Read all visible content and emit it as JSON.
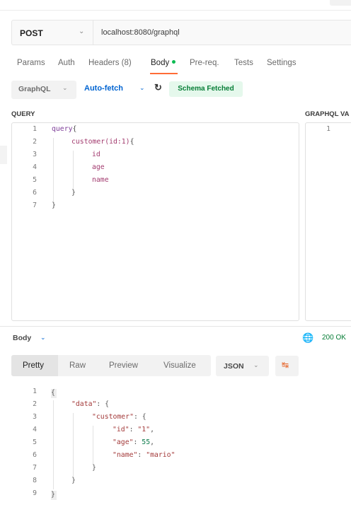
{
  "request": {
    "method": "POST",
    "url": "localhost:8080/graphql"
  },
  "tabs": [
    {
      "label": "Params"
    },
    {
      "label": "Auth"
    },
    {
      "label": "Headers (8)"
    },
    {
      "label": "Body"
    },
    {
      "label": "Pre-req."
    },
    {
      "label": "Tests"
    },
    {
      "label": "Settings"
    }
  ],
  "body_toolbar": {
    "mode": "GraphQL",
    "autofetch": "Auto-fetch",
    "schema_status": "Schema Fetched"
  },
  "query_section": {
    "label": "QUERY",
    "lines": [
      "1",
      "2",
      "3",
      "4",
      "5",
      "6",
      "7"
    ],
    "code": {
      "l1_kw": "query",
      "l1_b": "{",
      "l2_f": "customer",
      "l2_args": "(id:1)",
      "l2_b": "{",
      "l3": "id",
      "l4": "age",
      "l5": "name",
      "l6": "}",
      "l7": "}"
    }
  },
  "variables_section": {
    "label": "GRAPHQL VA",
    "line": "1"
  },
  "response": {
    "label": "Body",
    "status": "200 OK",
    "views": [
      "Pretty",
      "Raw",
      "Preview",
      "Visualize"
    ],
    "format": "JSON",
    "lines": [
      "1",
      "2",
      "3",
      "4",
      "5",
      "6",
      "7",
      "8",
      "9"
    ],
    "json": {
      "open": "{",
      "data_key": "\"data\"",
      "customer_key": "\"customer\"",
      "id_key": "\"id\"",
      "id_val": "\"1\"",
      "age_key": "\"age\"",
      "age_val": "55",
      "name_key": "\"name\"",
      "name_val": "\"mario\"",
      "close_inner": "}",
      "close_data": "}",
      "close": "}"
    }
  },
  "colors": {
    "accent": "#ff6c37",
    "link": "#0265d2",
    "success": "#067d36",
    "success_bg": "#e5f8ec"
  },
  "icons": [
    "chevron-down-icon",
    "refresh-icon",
    "globe-icon",
    "wrap-lines-icon"
  ]
}
